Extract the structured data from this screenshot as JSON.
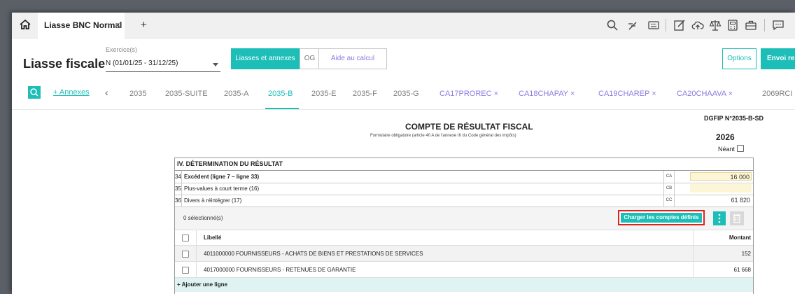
{
  "tabbar": {
    "tab_label": "Liasse BNC Normal",
    "tab_close": "×",
    "add_tab": "+"
  },
  "header": {
    "exercise_label": "Exercice(s)",
    "title": "Liasse fiscale",
    "exercise_value": "N (01/01/25 - 31/12/25)",
    "btn_liasses": "Liasses et annexes",
    "btn_og": "OG",
    "btn_aide": "Aide au calcul",
    "btn_options": "Options",
    "btn_envoi": "Envoi re"
  },
  "nav": {
    "annexes_link": "+ Annexes",
    "prev": "‹",
    "tabs": [
      {
        "label": "2035"
      },
      {
        "label": "2035-SUITE"
      },
      {
        "label": "2035-A"
      },
      {
        "label": "2035-B"
      },
      {
        "label": "2035-E"
      },
      {
        "label": "2035-F"
      },
      {
        "label": "2035-G"
      },
      {
        "label": "CA17PROREC ×"
      },
      {
        "label": "CA18CHAPAY ×"
      },
      {
        "label": "CA19CHAREP ×"
      },
      {
        "label": "CA20CHAAVA ×"
      },
      {
        "label": "2069RCI"
      }
    ],
    "active_tab": "2035-B"
  },
  "form": {
    "dgfip": "DGFIP N°2035-B-SD",
    "title": "COMPTE DE RÉSULTAT FISCAL",
    "subtitle": "Formulaire obligatoire (article 40 A de l'annexe III du Code général des impôts)",
    "year": "2026",
    "neant": "Néant",
    "section": "IV. DÉTERMINATION DU RÉSULTAT",
    "rows": [
      {
        "num": "34",
        "label": "Excédent (ligne 7 – ligne 33)",
        "code": "CA",
        "value": "16 000",
        "bold": true
      },
      {
        "num": "35",
        "label": "Plus-values à court terme (16)",
        "code": "CB",
        "value": ""
      },
      {
        "num": "36",
        "label": "Divers à réintégrer (17)",
        "code": "CC",
        "value": "61 820"
      }
    ],
    "selection_count": "0 sélectionné(s)",
    "btn_charger": "Charger les comptes définis",
    "col_libelle": "Libellé",
    "col_montant": "Montant",
    "lines": [
      {
        "label": "4011000000 FOURNISSEURS - ACHATS DE BIENS ET PRESTATIONS DE SERVICES",
        "amount": "152"
      },
      {
        "label": "4017000000 FOURNISSEURS - RETENUES DE GARANTIE",
        "amount": "61 668"
      }
    ],
    "add_line": "+ Ajouter une ligne"
  },
  "colors": {
    "accent": "#1cbeb7",
    "purple": "#8a7be0",
    "highlight": "#e02020"
  },
  "icons": [
    "home-icon",
    "search-icon",
    "magic-icon",
    "keyboard-icon",
    "edit-icon",
    "cloud-upload-icon",
    "balance-icon",
    "calculator-icon",
    "briefcase-icon",
    "chat-icon",
    "trash-icon",
    "more-vertical-icon"
  ]
}
